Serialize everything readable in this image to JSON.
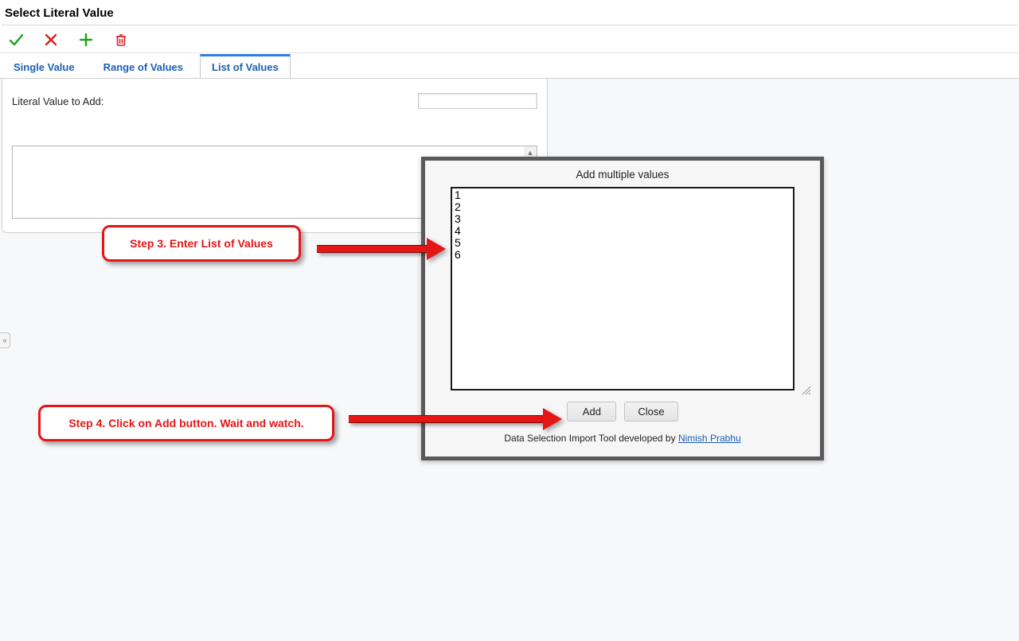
{
  "page_title": "Select Literal Value",
  "tabs": {
    "single": "Single Value",
    "range": "Range of Values",
    "list": "List of Values"
  },
  "field": {
    "label": "Literal Value to Add:",
    "value": ""
  },
  "modal": {
    "title": "Add multiple values",
    "textarea_value": "1\n2\n3\n4\n5\n6",
    "add_label": "Add",
    "close_label": "Close",
    "credit_prefix": "Data Selection Import Tool developed by ",
    "credit_link_text": "Nimish Prabhu"
  },
  "annotations": {
    "step3": "Step 3. Enter List of Values",
    "step4": "Step 4. Click on Add button. Wait and watch."
  },
  "collapse_glyph": "«"
}
